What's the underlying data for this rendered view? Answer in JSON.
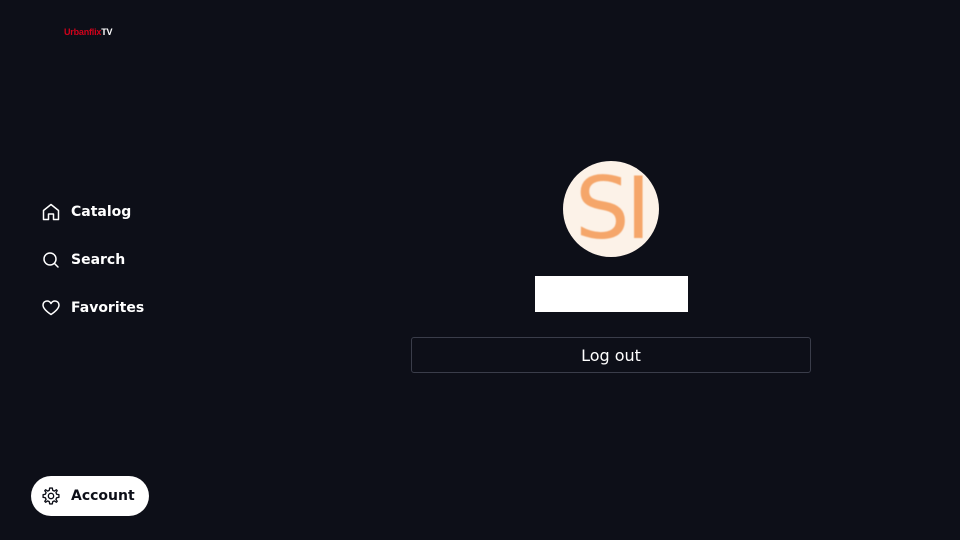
{
  "app": {
    "logo_brand": "Urbanflix",
    "logo_suffix": "TV"
  },
  "nav": {
    "items": [
      {
        "label": "Catalog",
        "icon": "home-icon"
      },
      {
        "label": "Search",
        "icon": "search-icon"
      },
      {
        "label": "Favorites",
        "icon": "heart-icon"
      }
    ],
    "account_label": "Account",
    "account_icon": "gear-icon"
  },
  "profile": {
    "avatar_initials": "SI",
    "name_value": "",
    "logout_label": "Log out"
  },
  "colors": {
    "background": "#0d0f18",
    "brand": "#d0021b",
    "avatar_bg": "#fcf2e8",
    "avatar_text": "#f5a66a"
  }
}
